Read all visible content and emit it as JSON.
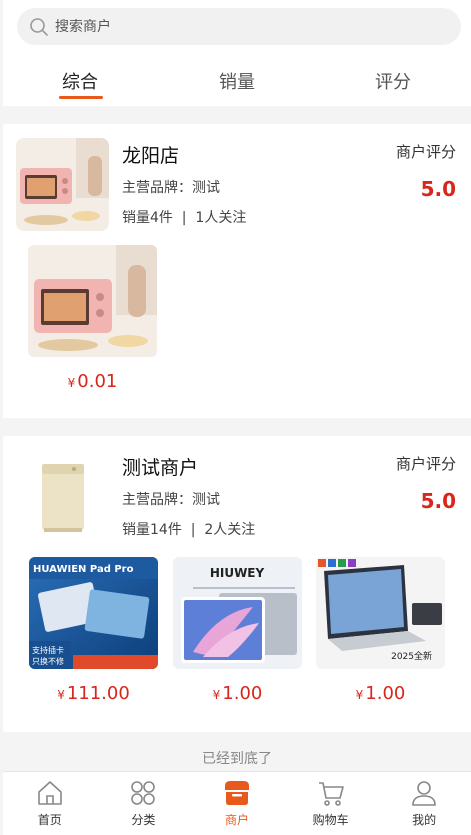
{
  "search": {
    "placeholder": "搜索商户"
  },
  "tabs": [
    {
      "label": "综合",
      "active": true
    },
    {
      "label": "销量",
      "active": false
    },
    {
      "label": "评分",
      "active": false
    }
  ],
  "merchants": [
    {
      "name": "龙阳店",
      "brand": "主营品牌：测试",
      "stats": "销量4件  |  1人关注",
      "rating_label": "商户评分",
      "rating": "5.0",
      "products": [
        {
          "price": "0.01",
          "currency": "¥"
        }
      ]
    },
    {
      "name": "测试商户",
      "brand": "主营品牌：测试",
      "stats": "销量14件  |  2人关注",
      "rating_label": "商户评分",
      "rating": "5.0",
      "products": [
        {
          "price": "111.00",
          "currency": "¥",
          "img_text_1": "HUAWIEN Pad Pro",
          "img_text_2": "支持插卡",
          "img_text_3": "只换不修"
        },
        {
          "price": "1.00",
          "currency": "¥",
          "img_text_1": "HIUWEY"
        },
        {
          "price": "1.00",
          "currency": "¥",
          "img_text_1": "2025全新"
        }
      ]
    }
  ],
  "end_text": "已经到底了",
  "tabbar": [
    {
      "label": "首页",
      "icon": "home-icon",
      "active": false
    },
    {
      "label": "分类",
      "icon": "category-icon",
      "active": false
    },
    {
      "label": "商户",
      "icon": "merchant-icon",
      "active": true
    },
    {
      "label": "购物车",
      "icon": "cart-icon",
      "active": false
    },
    {
      "label": "我的",
      "icon": "user-icon",
      "active": false
    }
  ],
  "colors": {
    "accent": "#e85a1c",
    "price": "#d9261c"
  }
}
